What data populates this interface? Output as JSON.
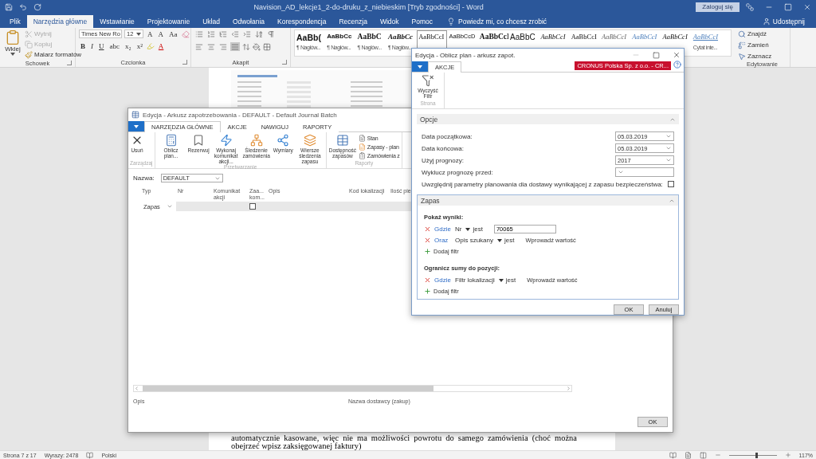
{
  "word": {
    "title": "Navision_AD_lekcje1_2-do-druku_z_niebieskim [Tryb zgodności]  -  Word",
    "sign_in": "Zaloguj się",
    "tabs": [
      {
        "label": "Plik",
        "selected": false
      },
      {
        "label": "Narzędzia główne",
        "selected": true
      },
      {
        "label": "Wstawianie",
        "selected": false
      },
      {
        "label": "Projektowanie",
        "selected": false
      },
      {
        "label": "Układ",
        "selected": false
      },
      {
        "label": "Odwołania",
        "selected": false
      },
      {
        "label": "Korespondencja",
        "selected": false
      },
      {
        "label": "Recenzja",
        "selected": false
      },
      {
        "label": "Widok",
        "selected": false
      },
      {
        "label": "Pomoc",
        "selected": false
      }
    ],
    "tell_me": "Powiedz mi, co chcesz zrobić",
    "share": "Udostępnij",
    "clipboard": {
      "label": "Schowek",
      "paste": "Wklej",
      "items": [
        {
          "label": "Wytnij",
          "disabled": true
        },
        {
          "label": "Kopiuj",
          "disabled": true
        },
        {
          "label": "Malarz formatów",
          "disabled": false
        }
      ]
    },
    "font": {
      "label": "Czcionka",
      "name": "Times New Ro",
      "size": "12",
      "grow": "A",
      "shrink": "A",
      "case": "Aa",
      "buttons": [
        "B",
        "I",
        "U",
        "abc",
        "x₂",
        "x²"
      ],
      "color_button": "A"
    },
    "paragraph": {
      "label": "Akapit",
      "align_buttons": [
        {
          "selected": false
        },
        {
          "selected": false
        },
        {
          "selected": false
        },
        {
          "selected": true
        }
      ]
    },
    "styles": [
      {
        "sample": "AaBb(",
        "caption": "¶ Nagłów...",
        "kind": "sans-large",
        "selected": false
      },
      {
        "sample": "AaBbCc",
        "caption": "¶ Nagłów...",
        "kind": "sans-bold",
        "selected": false
      },
      {
        "sample": "AaBbC",
        "caption": "¶ Nagłów...",
        "kind": "serif-bold",
        "selected": false
      },
      {
        "sample": "AaBbCc",
        "caption": "¶ Nagłów...",
        "kind": "serif-bold-italic",
        "selected": false
      },
      {
        "sample": "AaBbCcI",
        "kind": "serif",
        "selected": true
      },
      {
        "sample": "AaBbCcD",
        "kind": "sans",
        "selected": false
      },
      {
        "sample": "AaBbCcI",
        "kind": "serif-bold",
        "selected": false
      },
      {
        "sample": "AaBbC",
        "kind": "sans-big",
        "selected": false
      },
      {
        "sample": "AaBbCcI",
        "kind": "serif-italic",
        "selected": false
      },
      {
        "sample": "AaBbCcI",
        "kind": "serif",
        "selected": false
      },
      {
        "sample": "AaBbCcI",
        "kind": "serif-italic-grey",
        "selected": false
      },
      {
        "sample": "AaBbCcI",
        "kind": "serif-italic-blue",
        "selected": false
      },
      {
        "sample": "AaBbCcI",
        "kind": "serif-italic",
        "selected": false
      },
      {
        "sample": "AaBbCcI",
        "caption": "Cytat inte...",
        "kind": "serif-italic-blue-underline",
        "selected": false
      }
    ],
    "editing": {
      "label": "Edytowanie",
      "items": [
        "Znajdź",
        "Zamień",
        "Zaznacz"
      ]
    },
    "document_text": "automatycznie kasowane, więc nie ma możliwości powrotu do samego zamówienia (choć można obejrzeć wpisz zaksięgowanej faktury)",
    "status": {
      "page": "Strona 7 z 17",
      "words": "Wyrazy: 2478",
      "language": "Polski",
      "zoom": "117%",
      "level": 0.55
    }
  },
  "worksheet": {
    "title": "Edycja - Arkusz zapotrzebowania - DEFAULT - Default Journal Batch",
    "tabs": [
      {
        "label": "NARZĘDZIA GŁÓWNE",
        "selected": true
      },
      {
        "label": "AKCJE",
        "selected": false
      },
      {
        "label": "NAWIGUJ",
        "selected": false
      },
      {
        "label": "RAPORTY",
        "selected": false
      }
    ],
    "ribbon_groups": [
      {
        "label": "Zarządzaj",
        "actions": [
          {
            "label": "Usuń",
            "kind": "large"
          }
        ]
      },
      {
        "label": "Przetwarzanie",
        "actions": [
          {
            "label": "Oblicz plan...",
            "kind": "large"
          },
          {
            "label": "Rezerwuj",
            "kind": "large"
          },
          {
            "label": "Wykonaj komunikat akcji...",
            "kind": "large"
          },
          {
            "label": "Śledzenie zamówienia",
            "kind": "large"
          },
          {
            "label": "Wymiary",
            "kind": "large"
          },
          {
            "label": "Wiersze śledzenia zapasu",
            "kind": "large"
          }
        ]
      },
      {
        "label": "Raporty",
        "actions": [
          {
            "label": "Dostępność zapasów",
            "kind": "large"
          },
          {
            "label": "Stan",
            "kind": "small"
          },
          {
            "label": "Zapasy - plan",
            "kind": "small"
          },
          {
            "label": "Zamówienia z",
            "kind": "small"
          }
        ]
      }
    ],
    "name_label": "Nazwa:",
    "name_value": "DEFAULT",
    "columns": [
      "Typ",
      "Nr",
      "Komunikat akcji",
      "Zaa... kom...",
      "Opis",
      "Kod lokalizacji",
      "Ilość pie"
    ],
    "rows": [
      {
        "type": "Zapas",
        "accept": false
      }
    ],
    "factbox": [
      "Opis",
      "Nazwa dostawcy (zakup)"
    ],
    "ok": "OK"
  },
  "dialog": {
    "title": "Edycja - Oblicz plan - arkusz zapot.",
    "tabs": [
      {
        "label": "AKCJE",
        "selected": true
      }
    ],
    "company": "CRONUS Polska Sp. z o.o. - CR...",
    "action": {
      "label": "Wyczyść Filtr",
      "group": "Strona"
    },
    "options": {
      "title": "Opcje",
      "expanded": true,
      "fields": [
        {
          "label": "Data początkowa:",
          "value": "05.03.2019"
        },
        {
          "label": "Data końcowa:",
          "value": "05.03.2019"
        },
        {
          "label": "Użyj prognozy:",
          "value": "2017"
        },
        {
          "label": "Wyklucz prognozę przed:"
        }
      ],
      "checkbox": {
        "label": "Uwzględnij parametry planowania dla dostawy wynikającej z zapasu bezpieczeństwa:",
        "checked": false
      }
    },
    "stock": {
      "title": "Zapas",
      "expanded": true,
      "groups": [
        {
          "heading": "Pokaż wyniki:",
          "filters": [
            {
              "connector": "Gdzie",
              "field": "Nr",
              "operator": "jest",
              "value": "70065"
            },
            {
              "connector": "Oraz",
              "field": "Opis szukany",
              "operator": "jest",
              "placeholder": "Wprowadź wartość"
            }
          ],
          "add": "Dodaj filtr"
        },
        {
          "heading": "Ogranicz sumy do pozycji:",
          "filters": [
            {
              "connector": "Gdzie",
              "field": "Filtr lokalizacji",
              "operator": "jest",
              "placeholder": "Wprowadź wartość"
            }
          ],
          "add": "Dodaj filtr"
        }
      ]
    },
    "buttons": [
      "OK",
      "Anuluj"
    ]
  }
}
